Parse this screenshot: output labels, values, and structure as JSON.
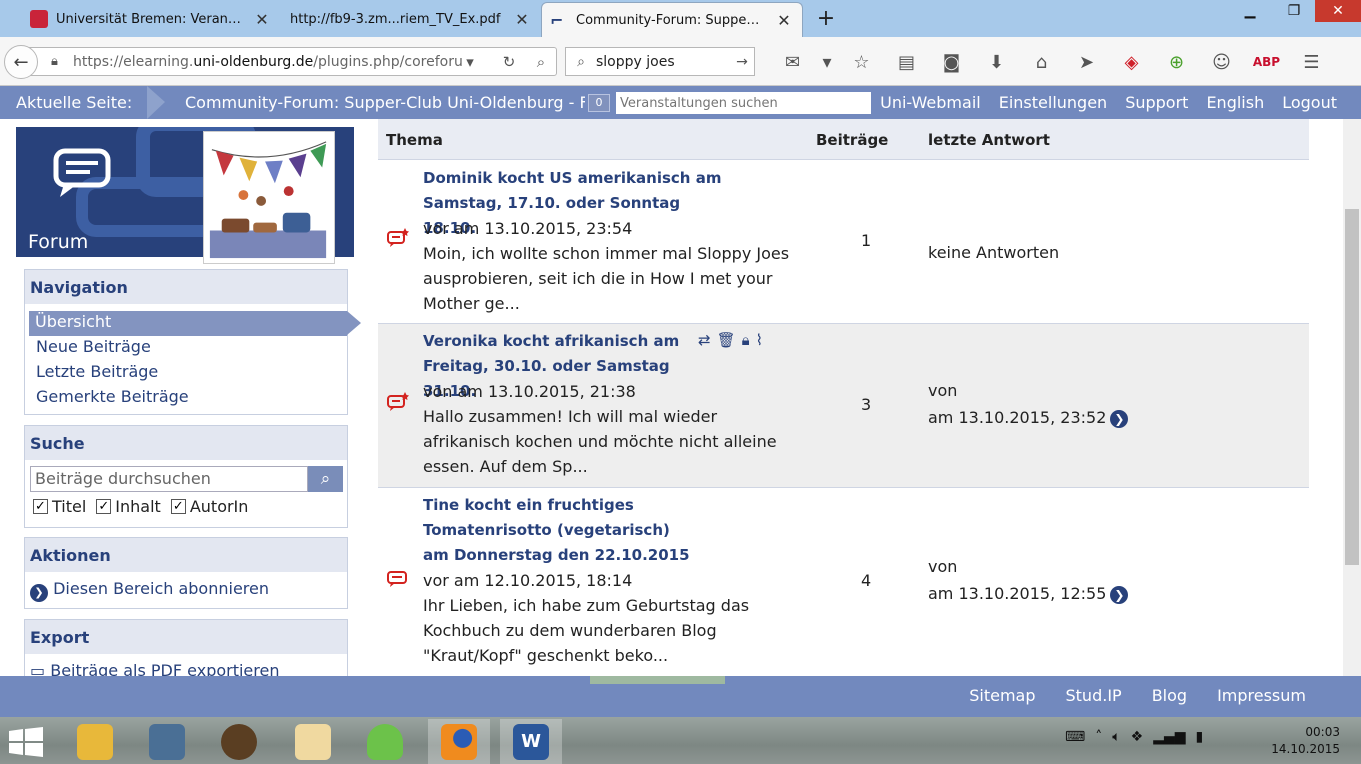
{
  "browser": {
    "tabs": [
      {
        "label": "Universität Bremen: Veran…",
        "active": false
      },
      {
        "label": "http://fb9-3.zm...riem_TV_Ex.pdf",
        "active": false
      },
      {
        "label": "Community-Forum: Suppe…",
        "active": true
      }
    ],
    "url_prefix": "https://elearning.",
    "url_domain": "uni-oldenburg.de",
    "url_path": "/plugins.php/coreforum",
    "search_value": "sloppy joes"
  },
  "studip": {
    "current_label": "Aktuelle Seite:",
    "current_page": "Community-Forum: Supper-Club Uni-Oldenburg - Forum",
    "badge": "0",
    "event_search_placeholder": "Veranstaltungen suchen",
    "top_links": [
      "Uni-Webmail",
      "Einstellungen",
      "Support",
      "English",
      "Logout"
    ]
  },
  "sidebar": {
    "banner_title": "Forum",
    "navigation": {
      "header": "Navigation",
      "items": [
        "Übersicht",
        "Neue Beiträge",
        "Letzte Beiträge",
        "Gemerkte Beiträge"
      ]
    },
    "search": {
      "header": "Suche",
      "placeholder": "Beiträge durchsuchen",
      "checkboxes": [
        "Titel",
        "Inhalt",
        "AutorIn"
      ]
    },
    "actions": {
      "header": "Aktionen",
      "subscribe": "Diesen Bereich abonnieren"
    },
    "export": {
      "header": "Export",
      "pdf": "Beiträge als PDF exportieren"
    }
  },
  "table": {
    "headers": {
      "topic": "Thema",
      "posts": "Beiträge",
      "last": "letzte Antwort"
    },
    "rows": [
      {
        "title": "Dominik kocht US amerikanisch am Samstag, 17.10. oder Sonntag 18.10.",
        "meta": "vor                    am 13.10.2015, 23:54",
        "excerpt": "Moin, ich wollte schon immer mal Sloppy Joes ausprobieren, seit ich die in How I met your Mother ge...",
        "count": "1",
        "last_line1": "keine Antworten",
        "last_line2": ""
      },
      {
        "title": "Veronika kocht afrikanisch am Freitag, 30.10. oder Samstag 31.10.",
        "meta": "von                     am 13.10.2015, 21:38",
        "excerpt": "Hallo zusammen! Ich will mal wieder afrikanisch kochen und möchte nicht alleine essen. Auf dem Sp...",
        "count": "3",
        "last_line1": "von",
        "last_line2": "am 13.10.2015, 23:52"
      },
      {
        "title": "Tine kocht ein fruchtiges Tomatenrisotto (vegetarisch) am Donnerstag den 22.10.2015",
        "meta": "vor                          am 12.10.2015, 18:14",
        "excerpt": "Ihr Lieben, ich habe zum Geburtstag das Kochbuch zu dem wunderbaren Blog \"Kraut/Kopf\" geschenkt beko...",
        "count": "4",
        "last_line1": "von",
        "last_line2": "am 13.10.2015, 12:55"
      }
    ]
  },
  "footer": {
    "links": [
      "Sitemap",
      "Stud.IP",
      "Blog",
      "Impressum"
    ]
  },
  "taskbar": {
    "time": "00:03",
    "date": "14.10.2015"
  }
}
